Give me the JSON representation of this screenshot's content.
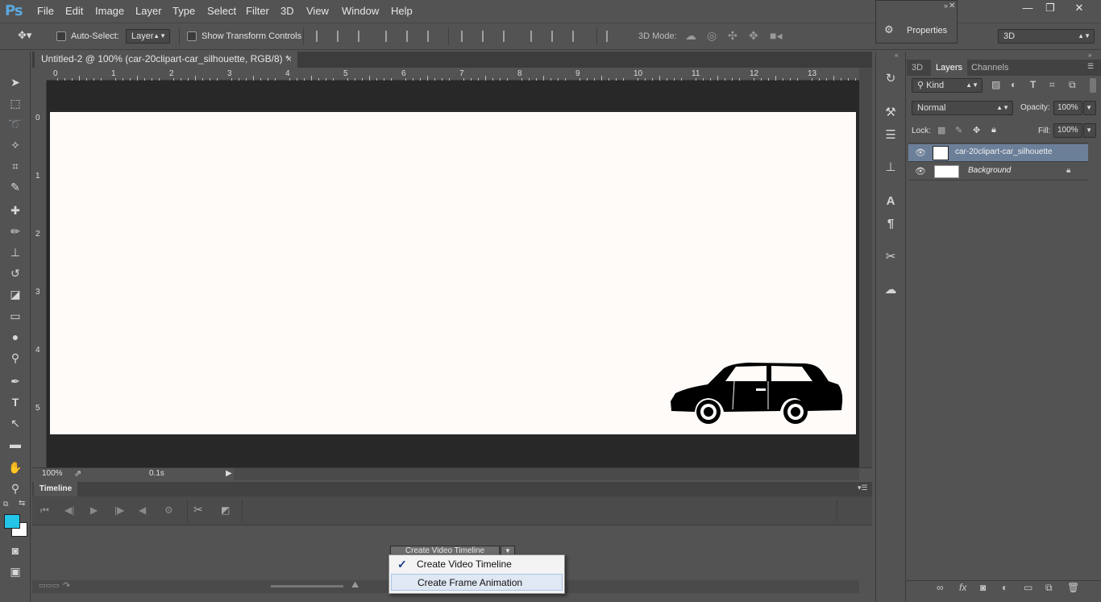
{
  "app": {
    "logo": "Ps"
  },
  "menu": [
    "File",
    "Edit",
    "Image",
    "Layer",
    "Type",
    "Select",
    "Filter",
    "3D",
    "View",
    "Window",
    "Help"
  ],
  "window_controls": {
    "minimize": "—",
    "restore": "❐",
    "close": "✕"
  },
  "options_bar": {
    "auto_select_label": "Auto-Select:",
    "auto_select_value": "Layer",
    "show_transform_label": "Show Transform Controls",
    "mode3d_label": "3D Mode:",
    "workspace_value": "3D"
  },
  "properties_panel": {
    "label": "Properties"
  },
  "document": {
    "tab_title": "Untitled-2 @ 100% (car-20clipart-car_silhouette, RGB/8) *",
    "tab_close": "×",
    "ruler_top": [
      "0",
      "1",
      "2",
      "3",
      "4",
      "5",
      "6",
      "7",
      "8",
      "9",
      "10",
      "11",
      "12",
      "13"
    ],
    "ruler_left": [
      "0",
      "1",
      "2",
      "3",
      "4",
      "5"
    ],
    "zoom": "100%",
    "frame_delay": "0.1s"
  },
  "timeline": {
    "tab": "Timeline",
    "create_button": "Create Video Timeline",
    "menu_items": [
      {
        "label": "Create Video Timeline",
        "checked": "✓"
      },
      {
        "label": "Create Frame Animation"
      }
    ]
  },
  "layers_panel": {
    "tabs": [
      "3D",
      "Layers",
      "Channels"
    ],
    "active_tab": "Layers",
    "filter_label": "Kind",
    "blend_mode": "Normal",
    "opacity_label": "Opacity:",
    "opacity_value": "100%",
    "lock_label": "Lock:",
    "fill_label": "Fill:",
    "fill_value": "100%",
    "layers": [
      {
        "name": "car-20clipart-car_silhouette",
        "selected": true
      },
      {
        "name": "Background",
        "locked": true
      }
    ]
  },
  "colors": {
    "foreground": "#23c6e8",
    "background": "#ffffff",
    "selection": "#6b7f99"
  }
}
